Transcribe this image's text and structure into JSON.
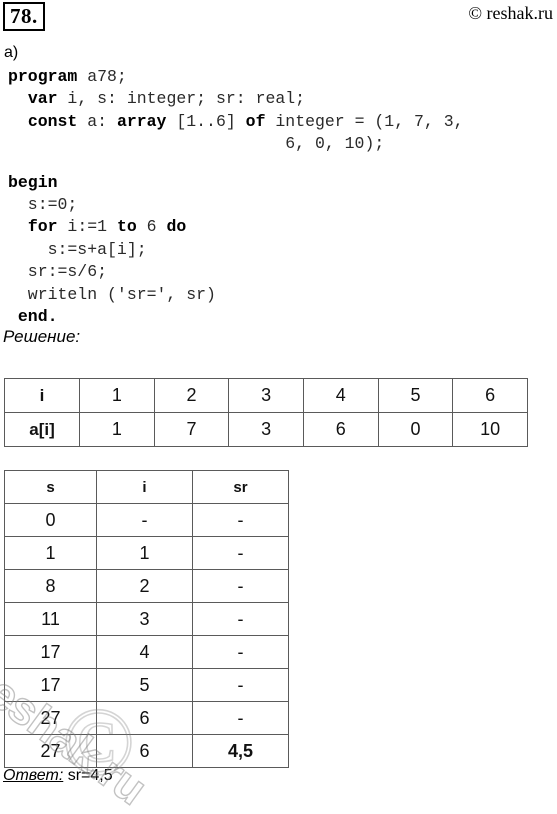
{
  "header": {
    "task_number": "78.",
    "site_credit": "© reshak.ru"
  },
  "part_label": "а)",
  "code": {
    "lines": [
      [
        {
          "t": "program",
          "b": true
        },
        {
          "t": " a78;",
          "b": false
        }
      ],
      [
        {
          "t": "  ",
          "b": false
        },
        {
          "t": "var",
          "b": true
        },
        {
          "t": " i, s: integer; sr: real;",
          "b": false
        }
      ],
      [
        {
          "t": "  ",
          "b": false
        },
        {
          "t": "const",
          "b": true
        },
        {
          "t": " a: ",
          "b": false
        },
        {
          "t": "array",
          "b": true
        },
        {
          "t": " [1..6] ",
          "b": false
        },
        {
          "t": "of",
          "b": true
        },
        {
          "t": " integer = (1, 7, 3,",
          "b": false
        }
      ],
      [
        {
          "t": "                            6, 0, 10);",
          "b": false
        }
      ],
      [
        {
          "t": "",
          "b": false
        }
      ],
      [
        {
          "t": "begin",
          "b": true
        }
      ],
      [
        {
          "t": "  s:=0;",
          "b": false
        }
      ],
      [
        {
          "t": "  ",
          "b": false
        },
        {
          "t": "for",
          "b": true
        },
        {
          "t": " i:=1 ",
          "b": false
        },
        {
          "t": "to",
          "b": true
        },
        {
          "t": " 6 ",
          "b": false
        },
        {
          "t": "do",
          "b": true
        }
      ],
      [
        {
          "t": "    s:=s+a[i];",
          "b": false
        }
      ],
      [
        {
          "t": "  sr:=s/6;",
          "b": false
        }
      ],
      [
        {
          "t": "  writeln ('sr=', sr)",
          "b": false
        }
      ],
      [
        {
          "t": " ",
          "b": false
        },
        {
          "t": "end.",
          "b": true
        }
      ]
    ]
  },
  "solution_label": "Решение:",
  "array_table": {
    "row_labels": [
      "i",
      "a[i]"
    ],
    "index_values": [
      "1",
      "2",
      "3",
      "4",
      "5",
      "6"
    ],
    "array_values": [
      "1",
      "7",
      "3",
      "6",
      "0",
      "10"
    ]
  },
  "trace_table": {
    "headers": [
      "s",
      "i",
      "sr"
    ],
    "rows": [
      {
        "s": "0",
        "i": "-",
        "sr": "-",
        "sr_bold": false
      },
      {
        "s": "1",
        "i": "1",
        "sr": "-",
        "sr_bold": false
      },
      {
        "s": "8",
        "i": "2",
        "sr": "-",
        "sr_bold": false
      },
      {
        "s": "11",
        "i": "3",
        "sr": "-",
        "sr_bold": false
      },
      {
        "s": "17",
        "i": "4",
        "sr": "-",
        "sr_bold": false
      },
      {
        "s": "17",
        "i": "5",
        "sr": "-",
        "sr_bold": false
      },
      {
        "s": "27",
        "i": "6",
        "sr": "-",
        "sr_bold": false
      },
      {
        "s": "27",
        "i": "6",
        "sr": "4,5",
        "sr_bold": true
      }
    ]
  },
  "answer": {
    "label": "Ответ:",
    "value": "sr=4,5"
  },
  "watermark": {
    "text": "reshak.ru",
    "copyright_glyph": "©"
  },
  "colors": {
    "page_background": "#ffffff",
    "text": "#000000",
    "table_border": "#5a5a5a",
    "code_text": "#2a2a2a",
    "watermark": "#787878"
  }
}
